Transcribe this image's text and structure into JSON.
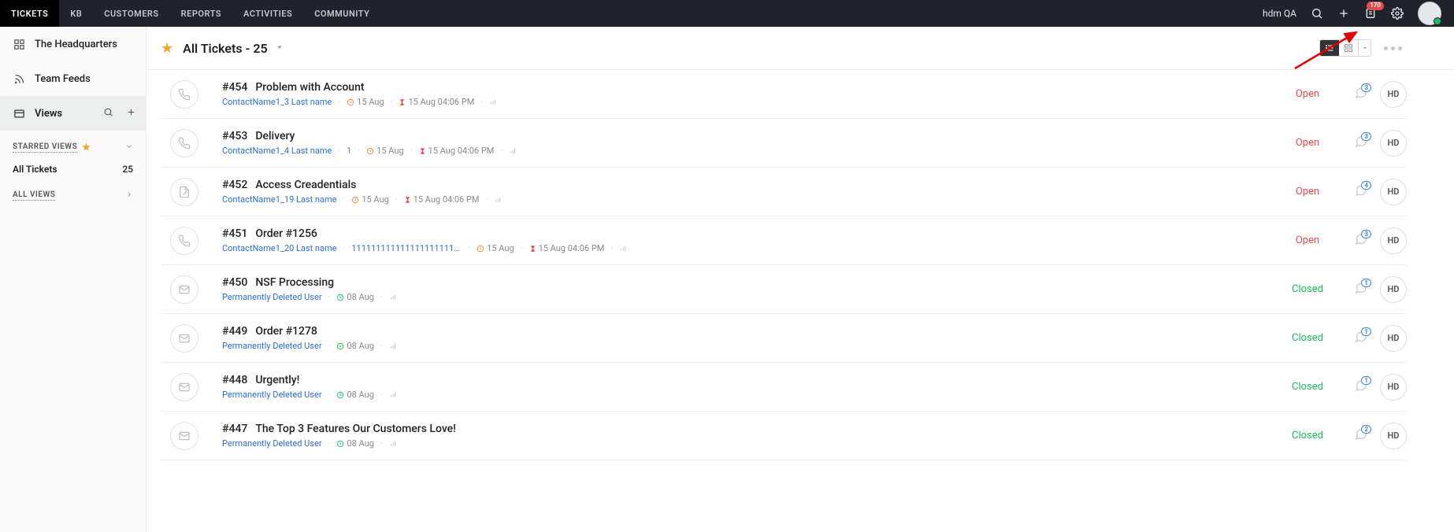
{
  "topnav": {
    "items": [
      "TICKETS",
      "KB",
      "CUSTOMERS",
      "REPORTS",
      "ACTIVITIES",
      "COMMUNITY"
    ],
    "active_index": 0,
    "user_label": "hdm QA",
    "notification_count": "170"
  },
  "sidebar": {
    "items": [
      {
        "icon": "grid",
        "label": "The Headquarters"
      },
      {
        "icon": "feed",
        "label": "Team Feeds"
      },
      {
        "icon": "views",
        "label": "Views",
        "active": true
      }
    ],
    "starred_header": "STARRED VIEWS",
    "starred_views": [
      {
        "label": "All Tickets",
        "count": "25"
      }
    ],
    "all_views_header": "ALL VIEWS"
  },
  "header": {
    "title": "All Tickets - 25"
  },
  "tickets": [
    {
      "channel": "phone",
      "num": "#454",
      "title": "Problem with Account",
      "contact": "ContactName1_3 Last name",
      "due": "15 Aug",
      "due_style": "orange",
      "overdue": "15 Aug 04:06 PM",
      "status": "Open",
      "status_class": "status-open",
      "comment_count": "3",
      "assignee": "HD"
    },
    {
      "channel": "phone",
      "num": "#453",
      "title": "Delivery",
      "contact": "ContactName1_4 Last name",
      "count": "1",
      "due": "15 Aug",
      "due_style": "orange",
      "overdue": "15 Aug 04:06 PM",
      "status": "Open",
      "status_class": "status-open",
      "comment_count": "3",
      "assignee": "HD"
    },
    {
      "channel": "edit",
      "num": "#452",
      "title": "Access Creadentials",
      "contact": "ContactName1_19 Last name",
      "due": "15 Aug",
      "due_style": "orange",
      "overdue": "15 Aug 04:06 PM",
      "status": "Open",
      "status_class": "status-open",
      "comment_count": "4",
      "assignee": "HD"
    },
    {
      "channel": "phone",
      "num": "#451",
      "title": "Order #1256",
      "contact": "ContactName1_20 Last name",
      "phone": "11111111111111111111111111111...",
      "due": "15 Aug",
      "due_style": "orange",
      "overdue": "15 Aug 04:06 PM",
      "status": "Open",
      "status_class": "status-open",
      "comment_count": "3",
      "assignee": "HD"
    },
    {
      "channel": "mail",
      "num": "#450",
      "title": "NSF Processing",
      "contact": "Permanently Deleted User",
      "due": "08 Aug",
      "due_style": "green",
      "status": "Closed",
      "status_class": "status-closed",
      "comment_count": "1",
      "assignee": "HD"
    },
    {
      "channel": "mail",
      "num": "#449",
      "title": "Order #1278",
      "contact": "Permanently Deleted User",
      "due": "08 Aug",
      "due_style": "green",
      "status": "Closed",
      "status_class": "status-closed",
      "comment_count": "1",
      "assignee": "HD"
    },
    {
      "channel": "mail",
      "num": "#448",
      "title": "Urgently!",
      "contact": "Permanently Deleted User",
      "due": "08 Aug",
      "due_style": "green",
      "status": "Closed",
      "status_class": "status-closed",
      "comment_count": "1",
      "assignee": "HD"
    },
    {
      "channel": "mail",
      "num": "#447",
      "title": "The Top 3 Features Our Customers Love!",
      "contact": "Permanently Deleted User",
      "due": "08 Aug",
      "due_style": "green",
      "status": "Closed",
      "status_class": "status-closed",
      "comment_count": "2",
      "assignee": "HD"
    }
  ]
}
